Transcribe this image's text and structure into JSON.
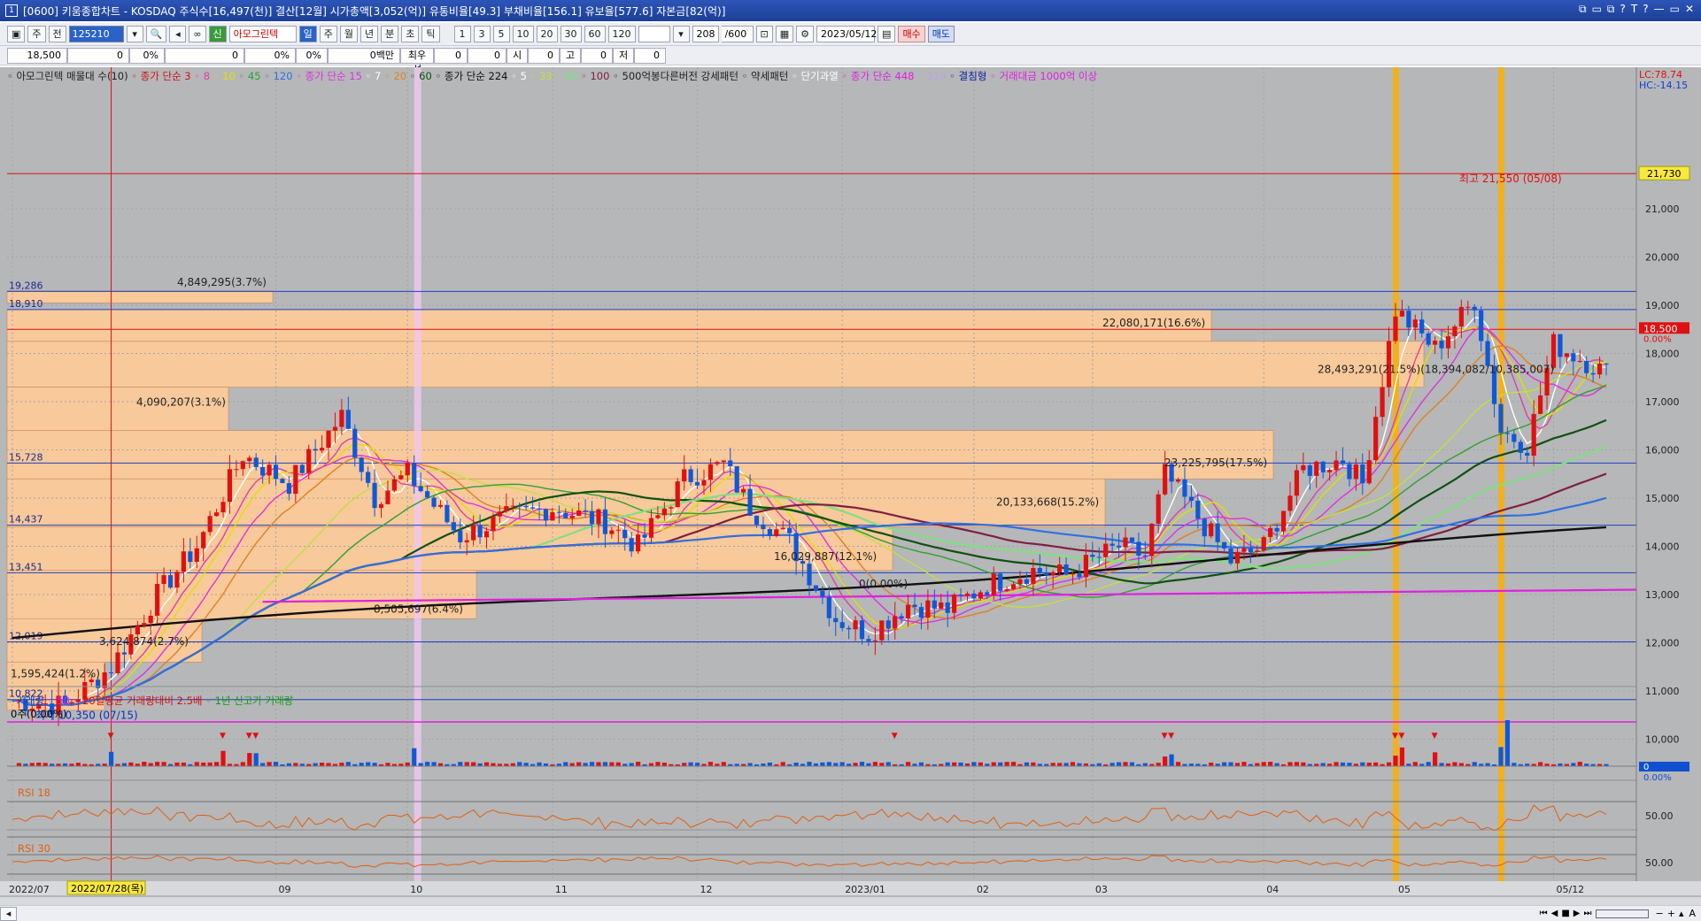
{
  "window": {
    "title": "[0600] 키움종합차트 - KOSDAQ 주식수[16,497(천)] 결산[12월] 시가총액[3,052(억)] 유통비율[49.3] 부채비율[156.1] 유보율[577.6] 자본금[82(억)]",
    "icon_label": "1",
    "controls": [
      "⧉",
      "▭",
      "⧉",
      "?",
      "T",
      "?",
      "—",
      "▭",
      "✕"
    ]
  },
  "toolbar": {
    "buttons_left": [
      "주",
      "전"
    ],
    "code_value": "125210",
    "stock_name": "아모그린텍",
    "period_buttons": [
      "일",
      "주",
      "월",
      "년",
      "분",
      "초",
      "틱"
    ],
    "interval_buttons": [
      "1",
      "3",
      "5",
      "10",
      "20",
      "30",
      "60",
      "120"
    ],
    "count_value": "208",
    "count_total": "/600",
    "date_value": "2023/05/12",
    "buy_label": "매수",
    "sell_label": "매도"
  },
  "infobar": {
    "price": "18,500",
    "change": "0",
    "change_pct": "0%",
    "vol": "0",
    "vol_pct": "0%",
    "vol2_pct": "0%",
    "amount": "0백만",
    "pref_label": "최우선",
    "pref_value": "0",
    "v1": "0",
    "open_label": "시",
    "open_value": "0",
    "high_label": "고",
    "high_value": "0",
    "low_label": "저",
    "low_value": "0"
  },
  "legend_main": [
    {
      "text": "아모그린텍 매물대 수(10)",
      "color": "#202020"
    },
    {
      "text": "종가 단순 3",
      "color": "#d01010"
    },
    {
      "text": "8",
      "color": "#e040a0"
    },
    {
      "text": "10",
      "color": "#e0e000"
    },
    {
      "text": "45",
      "color": "#30a030"
    },
    {
      "text": "120",
      "color": "#3070e0"
    },
    {
      "text": "종가 단순 15",
      "color": "#e030e0"
    },
    {
      "text": "7",
      "color": "#ffffff"
    },
    {
      "text": "20",
      "color": "#e08020"
    },
    {
      "text": "60",
      "color": "#105010"
    },
    {
      "text": "종가 단순 224",
      "color": "#101010"
    },
    {
      "text": "5",
      "color": "#ffffff"
    },
    {
      "text": "33",
      "color": "#c0e040"
    },
    {
      "text": "80",
      "color": "#80e080"
    },
    {
      "text": "100",
      "color": "#802040"
    },
    {
      "text": "500억봉다른버전 강세패턴",
      "color": "#202020"
    },
    {
      "text": "약세패턴",
      "color": "#202020"
    },
    {
      "text": "단기과열",
      "color": "#ffffff"
    },
    {
      "text": "종가 단순 448",
      "color": "#e020e0"
    },
    {
      "text": "116",
      "color": "#c0a0e0"
    },
    {
      "text": "결침형",
      "color": "#1020a0"
    },
    {
      "text": "거래대금 1000억 이상",
      "color": "#e020e0"
    }
  ],
  "right_info": {
    "lc": "LC:78.74",
    "hc": "HC:-14.15"
  },
  "price_axis": {
    "labels": [
      "21,000",
      "20,000",
      "19,000",
      "18,000",
      "17,000",
      "16,000",
      "15,000",
      "14,000",
      "13,000",
      "12,000",
      "11,000",
      "10,000"
    ],
    "high_box": "21,730",
    "current_box": "18,500",
    "current_pct": "0.00%"
  },
  "volume_axis": {
    "zero_box": "0",
    "zero_pct": "0.00%"
  },
  "rsi_axis": {
    "label1": "50.00",
    "label2": "50.00"
  },
  "levels": [
    {
      "label": "19,286"
    },
    {
      "label": "18,910"
    },
    {
      "label": "15,728"
    },
    {
      "label": "14,437"
    },
    {
      "label": "13,451"
    },
    {
      "label": "12,019"
    },
    {
      "label": "10,822"
    }
  ],
  "volume_profile": [
    {
      "label": "4,849,295(3.7%)"
    },
    {
      "label": "22,080,171(16.6%)"
    },
    {
      "label": "28,493,291(21.5%)(18,394,082/10,385,007)"
    },
    {
      "label": "4,090,207(3.1%)"
    },
    {
      "label": "23,225,795(17.5%)"
    },
    {
      "label": "20,133,668(15.2%)"
    },
    {
      "label": "16,029,887(12.1%)"
    },
    {
      "label": "0(0.00%)"
    },
    {
      "label": "8,505,697(6.4%)"
    },
    {
      "label": "3,624,874(2.7%)"
    },
    {
      "label": "1,595,424(1.2%)"
    }
  ],
  "annotations": {
    "high": "최고 21,550 (05/08)",
    "low": "최저 10,350 (07/15)"
  },
  "volume_legend": [
    {
      "text": "거래량",
      "color": "#0040c0"
    },
    {
      "text": "50",
      "color": "#e020e0"
    },
    {
      "text": "20일평균 거래량대비 2.5배",
      "color": "#d01010"
    },
    {
      "text": "1년 신고가 거래량",
      "color": "#10a010"
    }
  ],
  "volume_info": "0주(0.00%)",
  "rsi": [
    {
      "text": "RSI 18",
      "color": "#e06010"
    },
    {
      "text": "RSI 30",
      "color": "#e06010"
    }
  ],
  "x_axis": {
    "labels": [
      "2022/07",
      "09",
      "10",
      "11",
      "12",
      "2023/01",
      "02",
      "03",
      "04",
      "05",
      "05/12"
    ],
    "cursor_date": "2022/07/28(목)"
  },
  "colors": {
    "up": "#e01010",
    "down": "#1058d8",
    "background": "#b5b7b9",
    "profile": "#f8c99a"
  }
}
